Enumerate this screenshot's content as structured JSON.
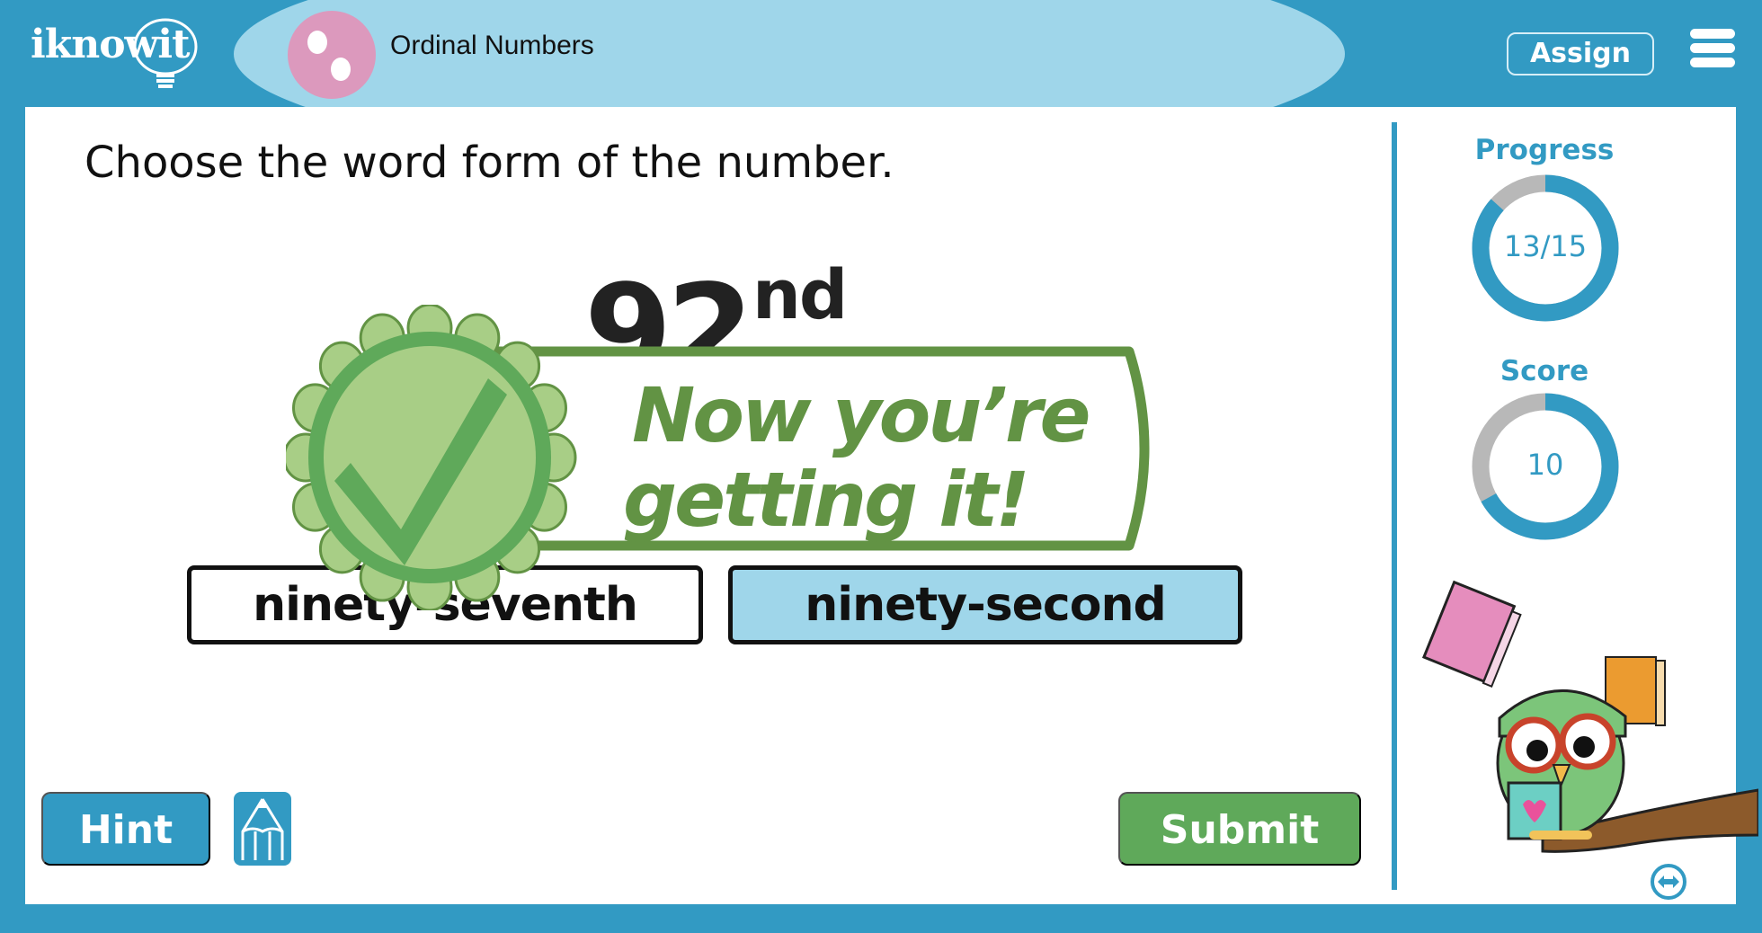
{
  "header": {
    "logo_text": "iknowit",
    "topic_title": "Ordinal Numbers",
    "assign_label": "Assign",
    "menu_icon": "hamburger-menu-icon"
  },
  "question": {
    "prompt": "Choose the word form of the number.",
    "number_main": "92",
    "number_suffix": "nd"
  },
  "choices": [
    {
      "label": "ninety-seventh",
      "selected": false
    },
    {
      "label": "ninety-second",
      "selected": true
    }
  ],
  "feedback": {
    "line1": "Now you’re",
    "line2": "getting it!",
    "icon": "checkmark-badge-icon"
  },
  "controls": {
    "hint_label": "Hint",
    "pencil_icon": "pencil-icon",
    "submit_label": "Submit"
  },
  "sidebar": {
    "progress": {
      "label": "Progress",
      "text": "13/15",
      "current": 13,
      "total": 15
    },
    "score": {
      "label": "Score",
      "text": "10",
      "fraction": 0.67
    },
    "swap_icon": "swap-horizontal-icon"
  },
  "colors": {
    "brand_blue": "#329ac3",
    "light_blue": "#9fd6ea",
    "ring_gray": "#b8b8b8",
    "success_green": "#5fa95a",
    "feedback_green": "#629344",
    "badge_light_green": "#a8ce86",
    "topic_pink": "#dc99bd"
  }
}
